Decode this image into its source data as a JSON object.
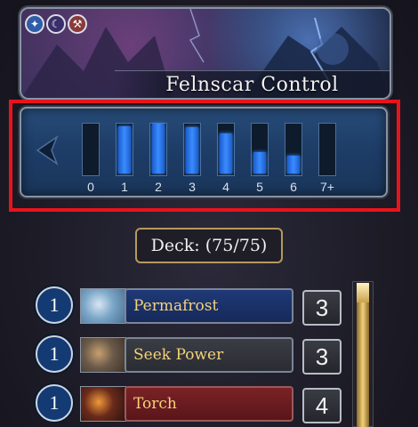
{
  "deck": {
    "name": "Felnscar Control",
    "regions": [
      {
        "icon": "paw-region-icon",
        "glyph": "✦",
        "color": "#2f5da8"
      },
      {
        "icon": "moon-region-icon",
        "glyph": "☾",
        "color": "#3a2f6a"
      },
      {
        "icon": "hammer-region-icon",
        "glyph": "⚒",
        "color": "#8a3a3a"
      }
    ],
    "count_label": "Deck: (75/75)"
  },
  "mana_curve": {
    "costs": [
      "0",
      "1",
      "2",
      "3",
      "4",
      "5",
      "6",
      "7+"
    ],
    "fill_fractions": [
      0,
      0.95,
      1.0,
      0.92,
      0.8,
      0.42,
      0.35,
      0
    ],
    "bar_color": "#3b8cff"
  },
  "cards": [
    {
      "cost": "1",
      "name": "Permafrost",
      "quantity": "3",
      "style": "blue"
    },
    {
      "cost": "1",
      "name": "Seek Power",
      "quantity": "3",
      "style": "gray"
    },
    {
      "cost": "1",
      "name": "Torch",
      "quantity": "4",
      "style": "red"
    }
  ]
}
